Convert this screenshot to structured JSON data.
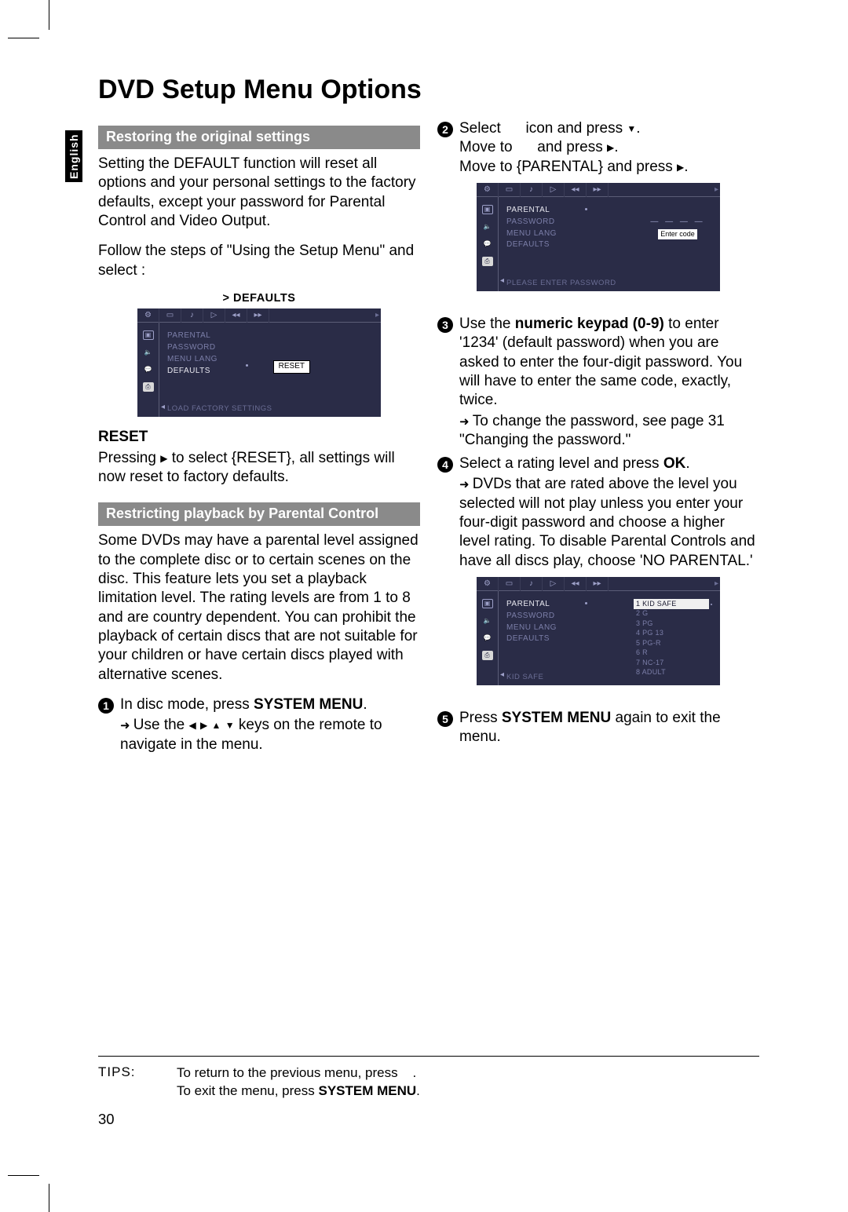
{
  "meta": {
    "language_tab": "English",
    "page_number": "30",
    "title": "DVD Setup Menu Options"
  },
  "left": {
    "section_restore": "Restoring the original settings",
    "para1": "Setting the DEFAULT function will reset all options and your personal settings to the factory defaults, except your password for Parental Control and Video Output.",
    "para2": "Follow the steps of \"Using the Setup Menu\" and select :",
    "osd_caption": "> DEFAULTS",
    "osd1": {
      "menu": [
        "PARENTAL",
        "PASSWORD",
        "MENU LANG",
        "DEFAULTS"
      ],
      "selected": "DEFAULTS",
      "value": "RESET",
      "footer": "LOAD FACTORY SETTINGS"
    },
    "reset_head": "RESET",
    "reset_text_a": "Pressing ",
    "reset_text_b": " to select {RESET},  all settings will now reset to factory defaults.",
    "section_parental": "Restricting playback by Parental Control",
    "parental_para": "Some DVDs may have a parental level assigned to the complete disc or to certain scenes on the disc.  This feature lets you set a playback limitation level.  The rating levels are from 1 to 8 and are country dependent.  You can prohibit the playback of certain discs that are not suitable for your children or have certain discs played with alternative scenes.",
    "step1_a": "In disc mode, press ",
    "step1_b": "SYSTEM MENU",
    "step1_c": ".",
    "step1_arrow_a": "Use the ",
    "step1_arrow_b": " keys on the remote to navigate in the menu."
  },
  "right": {
    "step2_a": "Select",
    "step2_b": "icon and press ",
    "step2_c": "Move to",
    "step2_d": "and press ",
    "step2_e": "Move to {PARENTAL} and press ",
    "osd2": {
      "menu": [
        "PARENTAL",
        "PASSWORD",
        "MENU LANG",
        "DEFAULTS"
      ],
      "selected": "PARENTAL",
      "input_label": "Enter code",
      "footer": "PLEASE ENTER PASSWORD"
    },
    "step3_a": "Use the ",
    "step3_b": "numeric keypad (0-9)",
    "step3_c": " to enter '1234' (default password) when you are asked to enter the four-digit password.  You will have to enter the same code, exactly, twice.",
    "step3_arrow": "To change the password, see page 31 \"Changing the password.\"",
    "step4_a": "Select a rating level and press ",
    "step4_b": "OK",
    "step4_c": ".",
    "step4_arrow": "DVDs that are rated above the level you selected will not play unless you enter your four-digit password and choose a higher level rating.  To disable Parental Controls and have all discs play, choose 'NO PARENTAL.'",
    "osd3": {
      "menu": [
        "PARENTAL",
        "PASSWORD",
        "MENU LANG",
        "DEFAULTS"
      ],
      "selected": "PARENTAL",
      "levels": [
        "1 KID SAFE",
        "2 G",
        "3 PG",
        "4 PG 13",
        "5 PG-R",
        "6 R",
        "7 NC-17",
        "8 ADULT"
      ],
      "level_selected": "1 KID SAFE",
      "footer": "KID SAFE"
    },
    "step5_a": "Press ",
    "step5_b": "SYSTEM MENU",
    "step5_c": " again to exit the menu."
  },
  "footer": {
    "tips_label": "TIPS:",
    "line1_a": "To return to the previous menu, press ",
    "line1_b": ".",
    "line2_a": "To exit the menu, press ",
    "line2_b": "SYSTEM MENU",
    "line2_c": "."
  }
}
